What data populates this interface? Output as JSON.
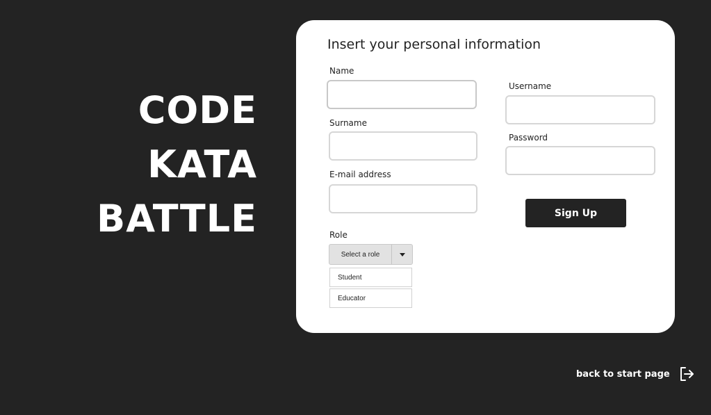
{
  "brand": {
    "line1": "CODE",
    "line2": "KATA",
    "line3": "BATTLE"
  },
  "form": {
    "title": "Insert your personal information",
    "name": {
      "label": "Name",
      "value": ""
    },
    "surname": {
      "label": "Surname",
      "value": ""
    },
    "email": {
      "label": "E-mail address",
      "value": ""
    },
    "username": {
      "label": "Username",
      "value": ""
    },
    "password": {
      "label": "Password",
      "value": ""
    },
    "role": {
      "label": "Role",
      "selected": "Select a role",
      "options": [
        "Student",
        "Educator"
      ]
    },
    "submit_label": "Sign Up"
  },
  "footer": {
    "back_label": "back to start page",
    "back_icon": "logout-arrow-icon"
  }
}
